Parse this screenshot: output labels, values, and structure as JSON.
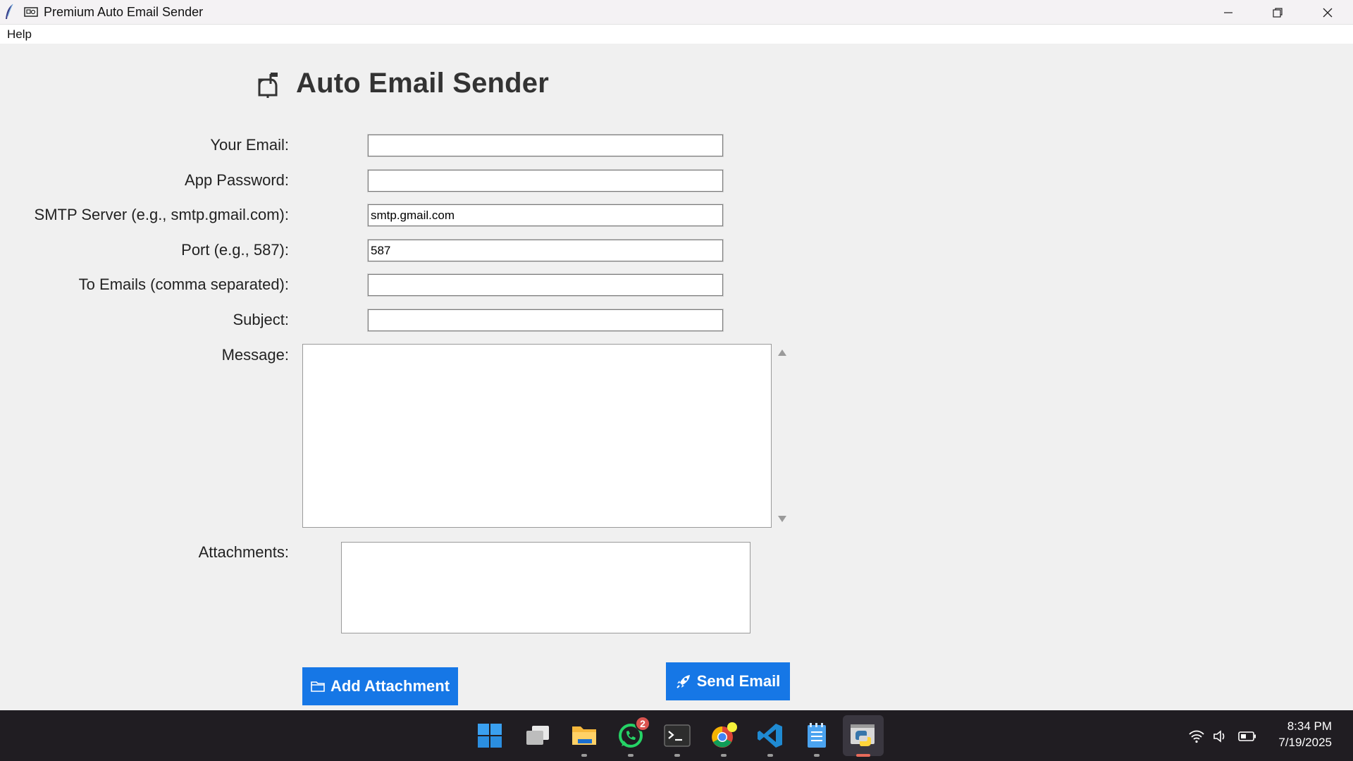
{
  "window": {
    "title": "Premium Auto Email Sender"
  },
  "menu": {
    "help": "Help"
  },
  "main": {
    "heading": "Auto Email Sender",
    "fields": {
      "your_email": {
        "label": "Your Email:",
        "value": ""
      },
      "app_password": {
        "label": "App Password:",
        "value": ""
      },
      "smtp_server": {
        "label": "SMTP Server (e.g., smtp.gmail.com):",
        "value": "smtp.gmail.com"
      },
      "port": {
        "label": "Port (e.g., 587):",
        "value": "587"
      },
      "to_emails": {
        "label": "To Emails (comma separated):",
        "value": ""
      },
      "subject": {
        "label": "Subject:",
        "value": ""
      }
    },
    "message_label": "Message:",
    "attachments_label": "Attachments:",
    "add_attachment_label": "Add Attachment",
    "send_email_label": "Send Email"
  },
  "taskbar": {
    "whatsapp_badge": "2",
    "time": "8:34 PM",
    "date": "7/19/2025"
  },
  "colors": {
    "button_blue": "#1677e6",
    "taskbar": "#201d22",
    "content_bg": "#f0f0f0"
  },
  "icons": [
    "feather-icon",
    "envelope-app-icon",
    "minimize-icon",
    "restore-icon",
    "close-icon",
    "mailbox-icon",
    "folder-icon",
    "rocket-icon",
    "windows-start-icon",
    "task-view-icon",
    "file-explorer-icon",
    "whatsapp-icon",
    "terminal-icon",
    "chrome-icon",
    "vscode-icon",
    "notepad-icon",
    "python-icon",
    "wifi-icon",
    "volume-icon",
    "battery-icon"
  ]
}
